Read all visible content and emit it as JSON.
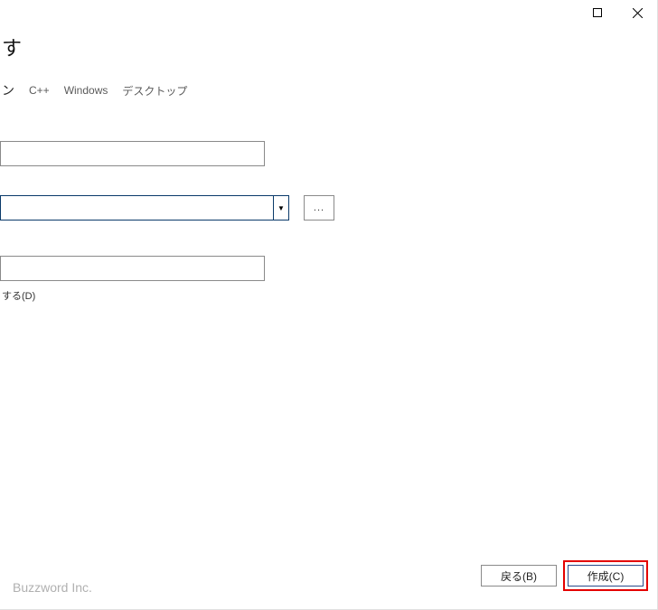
{
  "header": {
    "title_suffix": "す"
  },
  "tags": {
    "t1": "ン",
    "t2": "C++",
    "t3": "Windows",
    "t4": "デスクトップ"
  },
  "fields": {
    "name_value": "",
    "location_value": "",
    "solution_value": "",
    "checkbox_label": "する(D)",
    "browse_label": "..."
  },
  "buttons": {
    "back": "戻る(B)",
    "create": "作成(C)"
  },
  "watermark": "Buzzword Inc."
}
